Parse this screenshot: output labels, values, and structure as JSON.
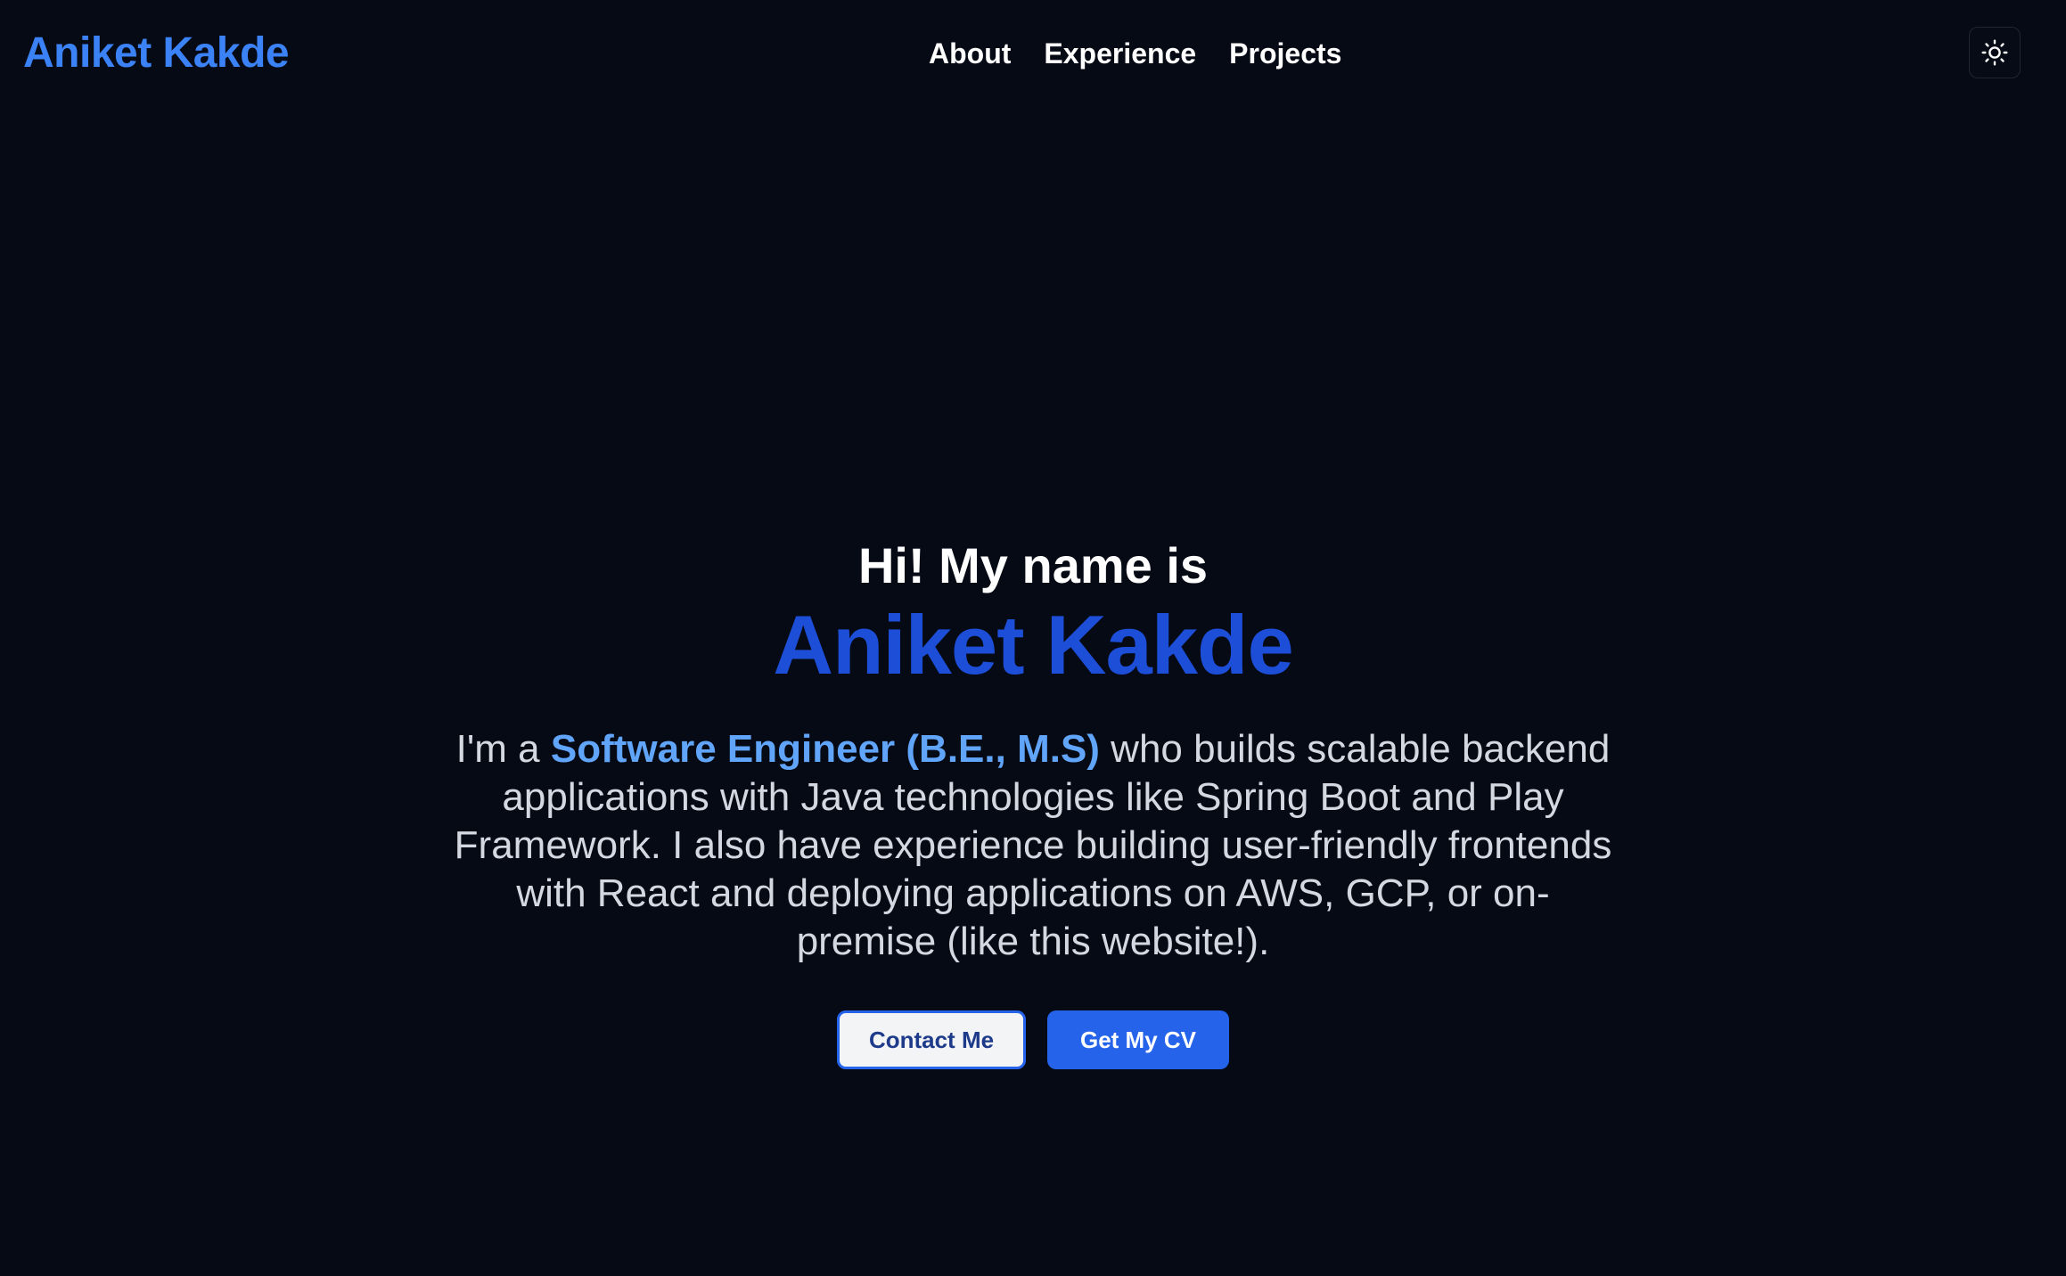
{
  "header": {
    "brand": "Aniket Kakde",
    "nav": [
      {
        "label": "About"
      },
      {
        "label": "Experience"
      },
      {
        "label": "Projects"
      }
    ],
    "theme_toggle_icon": "sun-icon"
  },
  "hero": {
    "greeting": "Hi! My name is",
    "name": "Aniket Kakde",
    "intro_prefix": "I'm a ",
    "intro_highlight": "Software Engineer (B.E., M.S)",
    "intro_suffix": " who builds scalable backend applications with Java technologies like Spring Boot and Play Framework. I also have experience building user-friendly frontends with React and deploying applications on AWS, GCP, or on-premise (like this website!).",
    "buttons": {
      "contact_label": "Contact Me",
      "cv_label": "Get My CV"
    }
  },
  "colors": {
    "background": "#060a15",
    "brand": "#3b82f6",
    "name": "#1d4ed8",
    "highlight": "#60a5fa",
    "primary_button": "#2563eb"
  }
}
